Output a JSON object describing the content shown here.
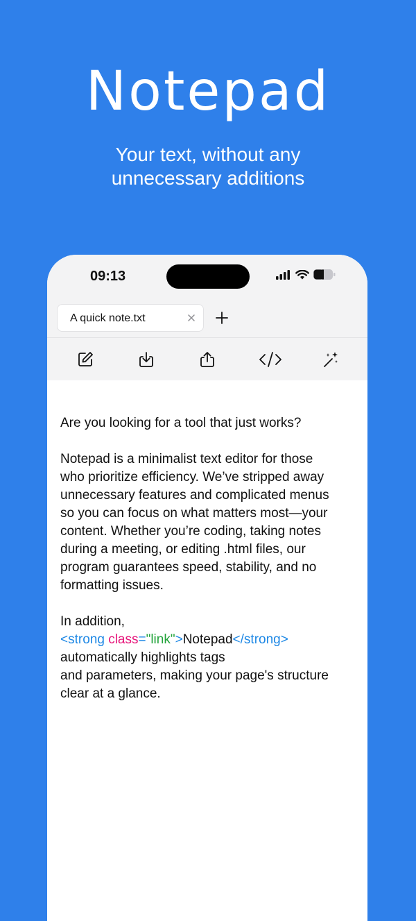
{
  "hero": {
    "title": "Notepad",
    "subtitle_line1": "Your text, without any",
    "subtitle_line2": "unnecessary additions"
  },
  "status_bar": {
    "time": "09:13",
    "icons": [
      "cellular-signal-icon",
      "wifi-icon",
      "battery-icon"
    ]
  },
  "tabs": [
    {
      "label": "A quick note.txt",
      "close_icon": "close-icon"
    }
  ],
  "new_tab_icon": "plus-icon",
  "toolbar": {
    "buttons": [
      "edit-icon",
      "download-icon",
      "share-icon",
      "code-icon",
      "magic-wand-icon"
    ]
  },
  "editor": {
    "line1": "Are you looking for a tool that just works?",
    "para2": [
      "Notepad is a minimalist text editor for those",
      "who prioritize efficiency. We’ve stripped away",
      "unnecessary features and complicated menus",
      "so you can focus on what matters most—your",
      "content. Whether you’re coding, taking notes",
      "during a meeting, or editing .html files, our",
      "program guarantees speed, stability, and no",
      "formatting issues."
    ],
    "para3_intro": "In addition,",
    "code": {
      "open_tag": "<strong ",
      "attr_name": "class",
      "equals": "=",
      "attr_value": "\"link\"",
      "open_tag_end": ">",
      "inner_text": "Notepad",
      "close_tag": "</strong>"
    },
    "para3_rest": [
      "automatically highlights tags",
      "and parameters, making your page's structure",
      "clear at a glance."
    ]
  },
  "colors": {
    "background": "#2f80ea",
    "tag": "#1e88e5",
    "attr": "#e6157a",
    "string": "#22a33a"
  }
}
